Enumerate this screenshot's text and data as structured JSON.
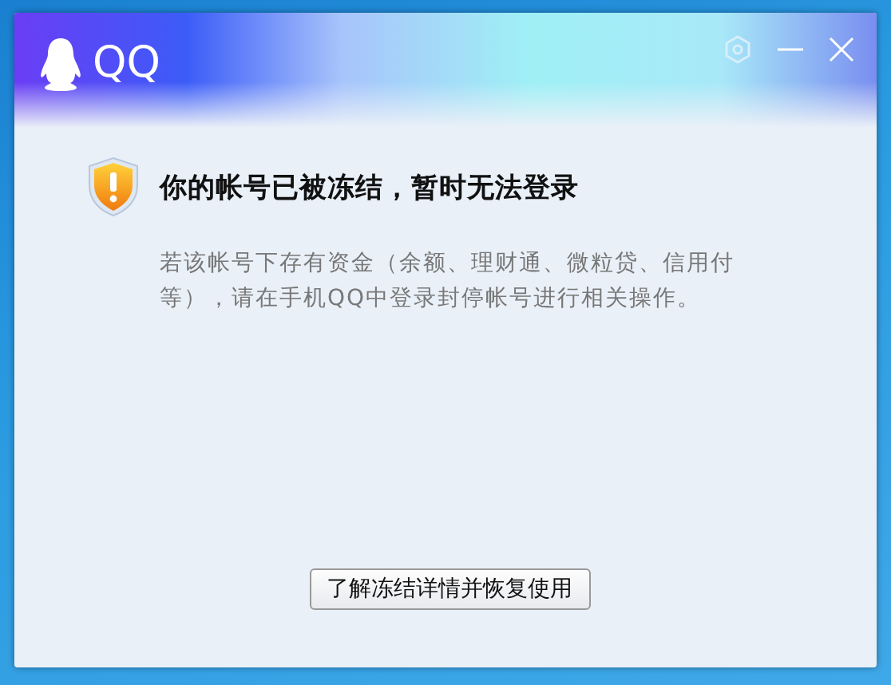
{
  "window": {
    "title": "QQ"
  },
  "message": {
    "heading": "你的帐号已被冻结，暂时无法登录",
    "body": "若该帐号下存有资金（余额、理财通、微粒贷、信用付等），请在手机QQ中登录封停帐号进行相关操作。"
  },
  "buttons": [
    "了解冻结详情并恢复使用"
  ]
}
